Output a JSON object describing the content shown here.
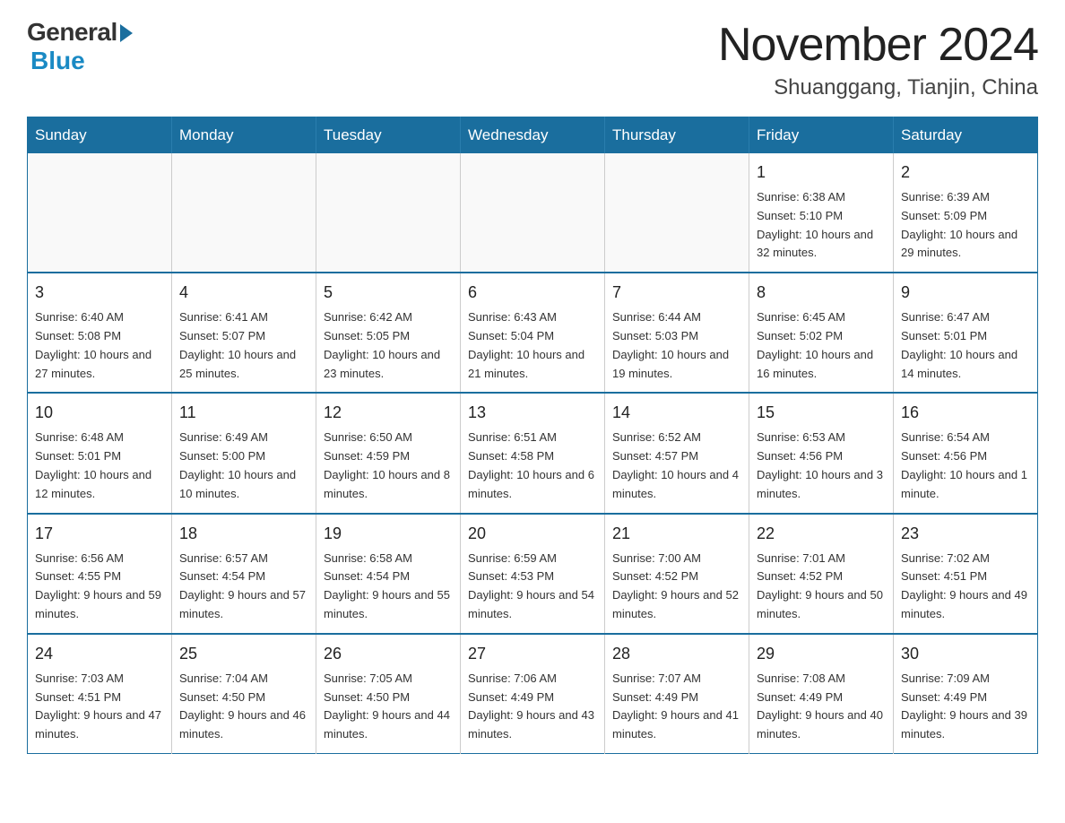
{
  "logo": {
    "general": "General",
    "blue": "Blue"
  },
  "header": {
    "month_year": "November 2024",
    "location": "Shuanggang, Tianjin, China"
  },
  "days_of_week": [
    "Sunday",
    "Monday",
    "Tuesday",
    "Wednesday",
    "Thursday",
    "Friday",
    "Saturday"
  ],
  "weeks": [
    [
      {
        "day": "",
        "info": ""
      },
      {
        "day": "",
        "info": ""
      },
      {
        "day": "",
        "info": ""
      },
      {
        "day": "",
        "info": ""
      },
      {
        "day": "",
        "info": ""
      },
      {
        "day": "1",
        "info": "Sunrise: 6:38 AM\nSunset: 5:10 PM\nDaylight: 10 hours and 32 minutes."
      },
      {
        "day": "2",
        "info": "Sunrise: 6:39 AM\nSunset: 5:09 PM\nDaylight: 10 hours and 29 minutes."
      }
    ],
    [
      {
        "day": "3",
        "info": "Sunrise: 6:40 AM\nSunset: 5:08 PM\nDaylight: 10 hours and 27 minutes."
      },
      {
        "day": "4",
        "info": "Sunrise: 6:41 AM\nSunset: 5:07 PM\nDaylight: 10 hours and 25 minutes."
      },
      {
        "day": "5",
        "info": "Sunrise: 6:42 AM\nSunset: 5:05 PM\nDaylight: 10 hours and 23 minutes."
      },
      {
        "day": "6",
        "info": "Sunrise: 6:43 AM\nSunset: 5:04 PM\nDaylight: 10 hours and 21 minutes."
      },
      {
        "day": "7",
        "info": "Sunrise: 6:44 AM\nSunset: 5:03 PM\nDaylight: 10 hours and 19 minutes."
      },
      {
        "day": "8",
        "info": "Sunrise: 6:45 AM\nSunset: 5:02 PM\nDaylight: 10 hours and 16 minutes."
      },
      {
        "day": "9",
        "info": "Sunrise: 6:47 AM\nSunset: 5:01 PM\nDaylight: 10 hours and 14 minutes."
      }
    ],
    [
      {
        "day": "10",
        "info": "Sunrise: 6:48 AM\nSunset: 5:01 PM\nDaylight: 10 hours and 12 minutes."
      },
      {
        "day": "11",
        "info": "Sunrise: 6:49 AM\nSunset: 5:00 PM\nDaylight: 10 hours and 10 minutes."
      },
      {
        "day": "12",
        "info": "Sunrise: 6:50 AM\nSunset: 4:59 PM\nDaylight: 10 hours and 8 minutes."
      },
      {
        "day": "13",
        "info": "Sunrise: 6:51 AM\nSunset: 4:58 PM\nDaylight: 10 hours and 6 minutes."
      },
      {
        "day": "14",
        "info": "Sunrise: 6:52 AM\nSunset: 4:57 PM\nDaylight: 10 hours and 4 minutes."
      },
      {
        "day": "15",
        "info": "Sunrise: 6:53 AM\nSunset: 4:56 PM\nDaylight: 10 hours and 3 minutes."
      },
      {
        "day": "16",
        "info": "Sunrise: 6:54 AM\nSunset: 4:56 PM\nDaylight: 10 hours and 1 minute."
      }
    ],
    [
      {
        "day": "17",
        "info": "Sunrise: 6:56 AM\nSunset: 4:55 PM\nDaylight: 9 hours and 59 minutes."
      },
      {
        "day": "18",
        "info": "Sunrise: 6:57 AM\nSunset: 4:54 PM\nDaylight: 9 hours and 57 minutes."
      },
      {
        "day": "19",
        "info": "Sunrise: 6:58 AM\nSunset: 4:54 PM\nDaylight: 9 hours and 55 minutes."
      },
      {
        "day": "20",
        "info": "Sunrise: 6:59 AM\nSunset: 4:53 PM\nDaylight: 9 hours and 54 minutes."
      },
      {
        "day": "21",
        "info": "Sunrise: 7:00 AM\nSunset: 4:52 PM\nDaylight: 9 hours and 52 minutes."
      },
      {
        "day": "22",
        "info": "Sunrise: 7:01 AM\nSunset: 4:52 PM\nDaylight: 9 hours and 50 minutes."
      },
      {
        "day": "23",
        "info": "Sunrise: 7:02 AM\nSunset: 4:51 PM\nDaylight: 9 hours and 49 minutes."
      }
    ],
    [
      {
        "day": "24",
        "info": "Sunrise: 7:03 AM\nSunset: 4:51 PM\nDaylight: 9 hours and 47 minutes."
      },
      {
        "day": "25",
        "info": "Sunrise: 7:04 AM\nSunset: 4:50 PM\nDaylight: 9 hours and 46 minutes."
      },
      {
        "day": "26",
        "info": "Sunrise: 7:05 AM\nSunset: 4:50 PM\nDaylight: 9 hours and 44 minutes."
      },
      {
        "day": "27",
        "info": "Sunrise: 7:06 AM\nSunset: 4:49 PM\nDaylight: 9 hours and 43 minutes."
      },
      {
        "day": "28",
        "info": "Sunrise: 7:07 AM\nSunset: 4:49 PM\nDaylight: 9 hours and 41 minutes."
      },
      {
        "day": "29",
        "info": "Sunrise: 7:08 AM\nSunset: 4:49 PM\nDaylight: 9 hours and 40 minutes."
      },
      {
        "day": "30",
        "info": "Sunrise: 7:09 AM\nSunset: 4:49 PM\nDaylight: 9 hours and 39 minutes."
      }
    ]
  ]
}
